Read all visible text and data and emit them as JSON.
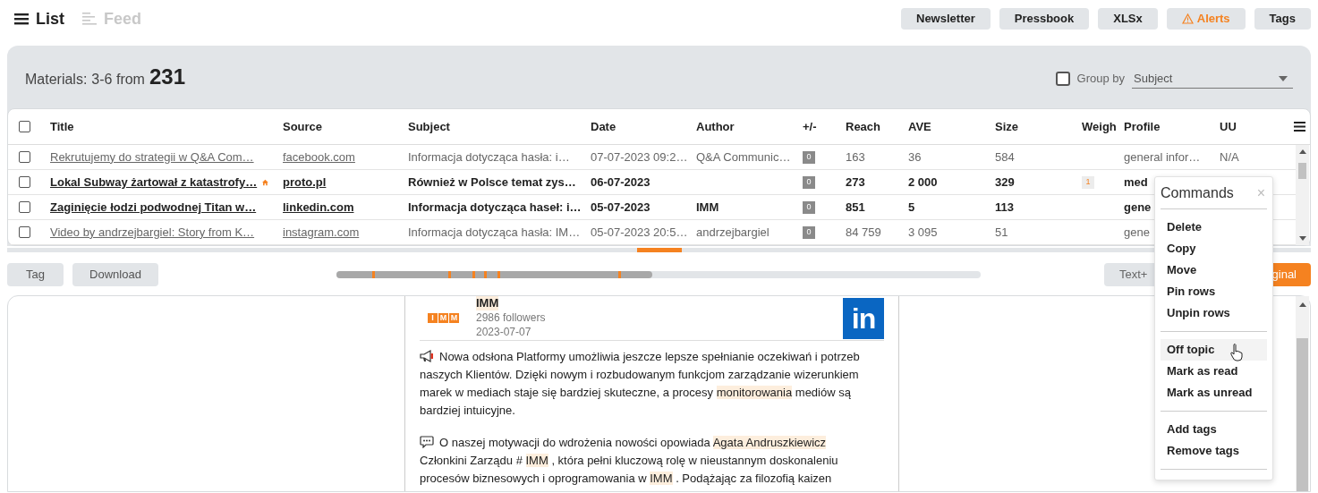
{
  "view_tabs": [
    {
      "label": "List",
      "selected": true
    },
    {
      "label": "Feed",
      "selected": false
    }
  ],
  "toolbar_buttons": [
    {
      "label": "Newsletter",
      "kind": "plain"
    },
    {
      "label": "Pressbook",
      "kind": "plain"
    },
    {
      "label": "XLSx",
      "kind": "plain"
    },
    {
      "label": "Alerts",
      "kind": "alert"
    },
    {
      "label": "Tags",
      "kind": "plain"
    }
  ],
  "materials": {
    "label": "Materials:",
    "range": "3-6 from",
    "total": "231"
  },
  "group_by": {
    "label": "Group by",
    "checked": false,
    "value": "Subject"
  },
  "table": {
    "select_all": false,
    "columns": [
      "Title",
      "Source",
      "Subject",
      "Date",
      "Author",
      "+/-",
      "Reach",
      "AVE",
      "Size",
      "Weigh",
      "Profile",
      "UU"
    ],
    "rows": [
      {
        "selected": false,
        "read": true,
        "home": false,
        "title": "Rekrutujemy do strategii w Q&A Com…",
        "source": "facebook.com",
        "subject": "Informacja dotycząca hasła: i…",
        "date": "07-07-2023 09:2…",
        "author": "Q&A Communic…",
        "plus_minus": "0",
        "reach": "163",
        "ave": "36",
        "size": "584",
        "profile": "general infor…",
        "uu": "N/A"
      },
      {
        "selected": false,
        "read": false,
        "home": true,
        "title": "Lokal Subway żartował z katastrofy…",
        "source": "proto.pl",
        "subject": "Również w Polsce temat zys…",
        "date": "06-07-2023",
        "plus_minus": "0",
        "reach": "273",
        "ave": "2 000",
        "size": "329",
        "weight": "1",
        "profile": "med"
      },
      {
        "selected": false,
        "read": false,
        "home": false,
        "title": "Zaginięcie łodzi podwodnej Titan w…",
        "source": "linkedin.com",
        "subject": "Informacja dotycząca haseł: i…",
        "date": "05-07-2023",
        "author": "IMM",
        "plus_minus": "0",
        "reach": "851",
        "ave": "5",
        "size": "113",
        "profile": "gene"
      },
      {
        "selected": false,
        "read": true,
        "home": false,
        "title": "Video by andrzejbargiel: Story from K…",
        "source": "instagram.com",
        "subject": "Informacja dotycząca hasła: IM…",
        "date": "05-07-2023 20:5…",
        "author": "andrzejbargiel",
        "plus_minus": "0",
        "reach": "84 759",
        "ave": "3 095",
        "size": "51",
        "profile": "gene"
      }
    ]
  },
  "actions": [
    {
      "label": "Tag"
    },
    {
      "label": "Download"
    }
  ],
  "timeline": {
    "level": 0.49
  },
  "view_buttons": [
    {
      "label": "Text+",
      "kind": "plain"
    },
    {
      "label": "ginal",
      "kind": "primary"
    }
  ],
  "post": {
    "logo_letters": [
      "I",
      "M",
      "M"
    ],
    "author": "IMM",
    "followers": "2986 followers",
    "date": "2023-07-07",
    "network_logo": "in",
    "paragraphs": [
      {
        "kind": "megaphone",
        "segments": [
          {
            "text": "Nowa odsłona Platformy umożliwia jeszcze lepsze spełnianie oczekiwań i potrzeb naszych Klientów. Dzięki nowym i rozbudowanym funkcjom zarządzanie wizerunkiem marek w mediach staje się bardziej skuteczne, a procesy ",
            "highlight": false
          },
          {
            "text": "monitorowania",
            "highlight": true
          },
          {
            "text": " mediów są bardziej intuicyjne.",
            "highlight": false
          }
        ]
      },
      {
        "kind": "speech",
        "segments": [
          {
            "text": "O naszej motywacji do wdrożenia nowości opowiada ",
            "highlight": false
          },
          {
            "text": "Agata Andruszkiewicz",
            "highlight": true
          },
          {
            "text": " Członkini Zarządu # ",
            "highlight": false
          },
          {
            "text": "IMM",
            "highlight": true
          },
          {
            "text": " , która pełni kluczową rolę w nieustannym doskonaleniu procesów biznesowych i oprogramowania w ",
            "highlight": false
          },
          {
            "text": "IMM",
            "highlight": true
          },
          {
            "text": " . Podążając za filozofią kaizen",
            "highlight": false
          }
        ]
      }
    ]
  },
  "commands": {
    "title": "Commands",
    "close": "×",
    "groups": [
      [
        {
          "label": "Delete",
          "hovered": false
        },
        {
          "label": "Copy",
          "hovered": false
        },
        {
          "label": "Move",
          "hovered": false
        },
        {
          "label": "Pin rows",
          "hovered": false
        },
        {
          "label": "Unpin rows",
          "hovered": false
        }
      ],
      [
        {
          "label": "Off topic",
          "hovered": true
        },
        {
          "label": "Mark as read",
          "hovered": false
        },
        {
          "label": "Mark as unread",
          "hovered": false
        }
      ],
      [
        {
          "label": "Add tags",
          "hovered": false
        },
        {
          "label": "Remove tags",
          "hovered": false
        }
      ]
    ]
  }
}
